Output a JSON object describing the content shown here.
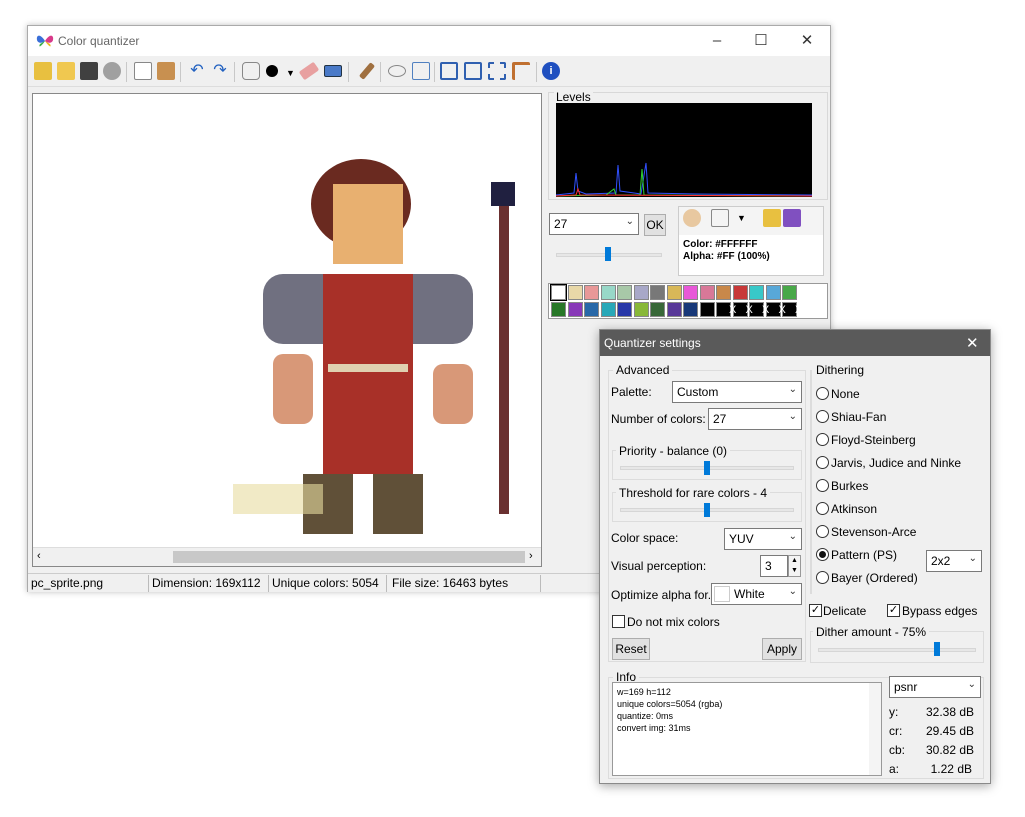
{
  "app": {
    "title": "Color quantizer",
    "window_controls": [
      "minimize",
      "maximize",
      "close"
    ]
  },
  "toolbar": {
    "icons": [
      "open-icon",
      "open-folder-icon",
      "save-icon",
      "settings-gear-icon",
      "copy-icon",
      "paste-icon",
      "undo-icon",
      "redo-icon",
      "mask-icon",
      "color-dot-icon",
      "eraser-icon",
      "rectangle-icon",
      "brush-icon",
      "eye-icon",
      "preview-icon",
      "fit-icon",
      "fullscreen-icon",
      "crop-icon",
      "pixel-icon",
      "info-icon"
    ]
  },
  "status": {
    "file": "pc_sprite.png",
    "dimension": "Dimension: 169x112",
    "unique": "Unique colors: 5054",
    "size": "File size: 16463 bytes"
  },
  "levels": {
    "label": "Levels"
  },
  "side": {
    "colors_value": "27",
    "ok_label": "OK",
    "color_text": "Color: #FFFFFF",
    "alpha_text": "Alpha: #FF (100%)"
  },
  "palette": {
    "row1": [
      "#ffffff",
      "#e8d8a8",
      "#e89898",
      "#98d8c8",
      "#a8c8a8",
      "#a8a8c8",
      "#787878",
      "#d8b858",
      "#e858d8",
      "#d87898",
      "#c8884a",
      "#c83838",
      "#38c8c8",
      "#58a8d8",
      "#48a848"
    ],
    "row2": [
      "#287828",
      "#8838b8",
      "#2868a8",
      "#28a8b8",
      "#2838a8",
      "#88b838",
      "#386838",
      "#583898",
      "#183878",
      "#000000",
      "#000000",
      "#000000",
      "#000000",
      "#000000",
      "#000000"
    ],
    "row2_x": [
      "X",
      "X",
      "X",
      "X",
      "X"
    ]
  },
  "quantizer": {
    "title": "Quantizer settings",
    "advanced_label": "Advanced",
    "palette_label": "Palette:",
    "palette_value": "Custom",
    "num_colors_label": "Number of colors:",
    "num_colors_value": "27",
    "priority_label": "Priority - balance (0)",
    "threshold_label": "Threshold for rare colors - 4",
    "colorspace_label": "Color space:",
    "colorspace_value": "YUV",
    "visual_label": "Visual perception:",
    "visual_value": "3",
    "optimize_label": "Optimize alpha for...",
    "optimize_value": "White",
    "no_mix_label": "Do not mix colors",
    "reset_label": "Reset",
    "apply_label": "Apply",
    "dithering_label": "Dithering",
    "dither_options": [
      "None",
      "Shiau-Fan",
      "Floyd-Steinberg",
      "Jarvis, Judice and Ninke",
      "Burkes",
      "Atkinson",
      "Stevenson-Arce",
      "Pattern (PS)",
      "Bayer (Ordered)"
    ],
    "dither_selected": "Pattern (PS)",
    "pattern_size": "2x2",
    "delicate_label": "Delicate",
    "bypass_label": "Bypass edges",
    "dither_amount_label": "Dither amount - 75%",
    "dither_amount": 0.75,
    "priority_level": 0.5,
    "threshold_level": 0.5,
    "info_label": "Info",
    "info_lines": [
      "w=169 h=112",
      "unique colors=5054 (rgba)",
      "quantize: 0ms",
      "convert img: 31ms"
    ],
    "metric": "psnr",
    "metrics": [
      {
        "k": "y:",
        "v": "32.38 dB"
      },
      {
        "k": "cr:",
        "v": "29.45 dB"
      },
      {
        "k": "cb:",
        "v": "30.82 dB"
      },
      {
        "k": "a:",
        "v": "1.22 dB"
      }
    ]
  }
}
